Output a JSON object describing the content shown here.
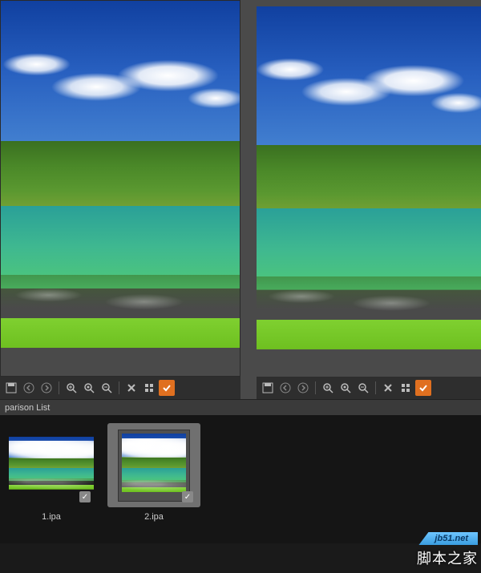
{
  "panel": {
    "title": "parison List"
  },
  "toolbar": {
    "save": "save-icon",
    "back": "arrow-left-icon",
    "forward": "arrow-right-icon",
    "zoom_in": "zoom-in-icon",
    "zoom_fit": "zoom-fit-icon",
    "zoom_out": "zoom-out-icon",
    "close": "close-icon",
    "grid": "grid-icon",
    "check": "check-icon"
  },
  "thumbs": [
    {
      "label": "1.ipa",
      "selected": false
    },
    {
      "label": "2.ipa",
      "selected": true
    }
  ],
  "watermark": {
    "tag": "jb51.net",
    "text": "脚本之家"
  }
}
